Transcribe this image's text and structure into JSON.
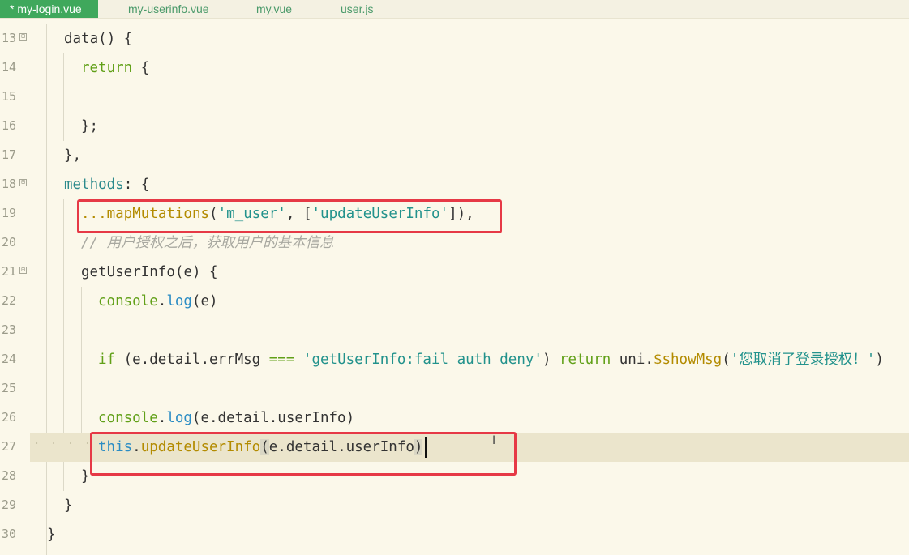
{
  "tabs": [
    {
      "label": "* my-login.vue"
    },
    {
      "label": "my-userinfo.vue"
    },
    {
      "label": "my.vue"
    },
    {
      "label": "user.js"
    }
  ],
  "lines": [
    {
      "num": "13",
      "fold": "⊟"
    },
    {
      "num": "14"
    },
    {
      "num": "15"
    },
    {
      "num": "16"
    },
    {
      "num": "17"
    },
    {
      "num": "18",
      "fold": "⊟"
    },
    {
      "num": "19"
    },
    {
      "num": "20"
    },
    {
      "num": "21",
      "fold": "⊟"
    },
    {
      "num": "22"
    },
    {
      "num": "23"
    },
    {
      "num": "24"
    },
    {
      "num": "25"
    },
    {
      "num": "26"
    },
    {
      "num": "27"
    },
    {
      "num": "28"
    },
    {
      "num": "29"
    },
    {
      "num": "30"
    }
  ],
  "code": {
    "l13": {
      "t1": "data",
      "t2": "() {"
    },
    "l14": {
      "t1": "return",
      "t2": " {"
    },
    "l16": {
      "t1": "};"
    },
    "l17": {
      "t1": "},"
    },
    "l18": {
      "t1": "methods",
      "t2": ": {"
    },
    "l19": {
      "t1": "...",
      "t2": "mapMutations",
      "t3": "(",
      "t4": "'m_user'",
      "t5": ", [",
      "t6": "'updateUserInfo'",
      "t7": "]),"
    },
    "l20": {
      "t1": "// 用户授权之后，获取用户的基本信息"
    },
    "l21": {
      "t1": "getUserInfo",
      "t2": "(e) {"
    },
    "l22": {
      "t1": "console",
      "t2": ".",
      "t3": "log",
      "t4": "(e)"
    },
    "l24": {
      "t1": "if",
      "t2": " (e.",
      "t3": "detail",
      "t4": ".",
      "t5": "errMsg",
      "t6": " ",
      "t7": "===",
      "t8": " ",
      "t9": "'getUserInfo:fail auth deny'",
      "t10": ") ",
      "t11": "return",
      "t12": " uni.",
      "t13": "$showMsg",
      "t14": "(",
      "t15": "'您取消了登录授权！'",
      "t16": ")"
    },
    "l26": {
      "t1": "console",
      "t2": ".",
      "t3": "log",
      "t4": "(e.",
      "t5": "detail",
      "t6": ".",
      "t7": "userInfo",
      "t8": ")"
    },
    "l27": {
      "dots": "· · · · ·",
      "t1": "this",
      "t2": ".",
      "t3": "updateUserInfo",
      "t4": "(",
      "t5": "e.",
      "t6": "detail",
      "t7": ".",
      "t8": "userInfo",
      "t9": ")"
    },
    "l28": {
      "t1": "}"
    },
    "l29": {
      "t1": "}"
    },
    "l30": {
      "t1": "}"
    }
  },
  "colors": {
    "background": "#fbf8ea",
    "active_tab": "#3fa85c",
    "current_line": "#ebe5cc",
    "highlight_box": "#e63946"
  },
  "icons": [
    "fold-collapse-icon",
    "text-cursor-icon"
  ]
}
